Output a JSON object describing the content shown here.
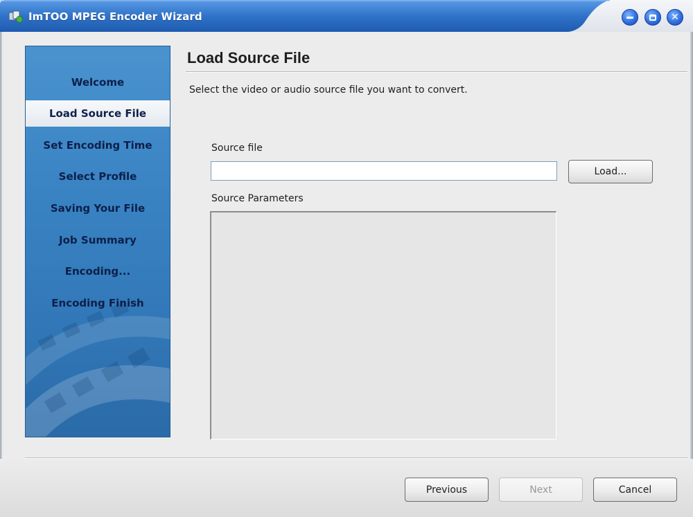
{
  "window": {
    "title": "ImTOO MPEG Encoder Wizard",
    "accent_color": "#2f73c9",
    "controls": [
      "minimize-icon",
      "maximize-icon",
      "close-icon"
    ]
  },
  "sidebar": {
    "steps": [
      {
        "label": "Welcome",
        "active": false
      },
      {
        "label": "Load Source File",
        "active": true
      },
      {
        "label": "Set Encoding Time",
        "active": false
      },
      {
        "label": "Select Profile",
        "active": false
      },
      {
        "label": "Saving Your File",
        "active": false
      },
      {
        "label": "Job Summary",
        "active": false
      },
      {
        "label": "Encoding...",
        "active": false
      },
      {
        "label": "Encoding Finish",
        "active": false
      }
    ]
  },
  "main": {
    "title": "Load Source File",
    "instruction": "Select the video or audio source file you want to convert.",
    "source_file_label": "Source file",
    "source_file_value": "",
    "load_button": "Load...",
    "source_params_label": "Source Parameters"
  },
  "footer": {
    "previous": "Previous",
    "next": "Next",
    "next_enabled": false,
    "cancel": "Cancel"
  }
}
